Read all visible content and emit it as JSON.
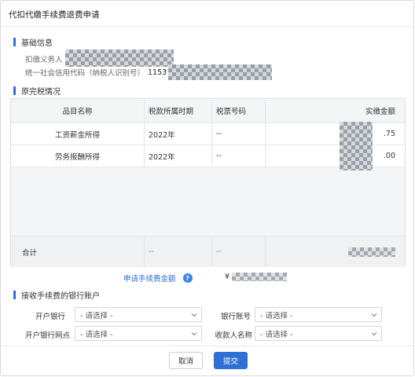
{
  "dialog": {
    "title": "代扣代缴手续费退费申请"
  },
  "basic_info": {
    "section_title": "基础信息",
    "withholder_label": "扣缴义务人",
    "credit_code_label": "统一社会信用代码（纳税人识别号）",
    "credit_code_value": "1153"
  },
  "tax_status": {
    "section_title": "原完税情况",
    "columns": [
      "品目名称",
      "税款所属时期",
      "税票号码",
      "实缴金额"
    ],
    "rows": [
      {
        "item": "工资薪金所得",
        "period": "2022年",
        "ticket": "--",
        "amount_suffix": ".75"
      },
      {
        "item": "劳务报酬所得",
        "period": "2022年",
        "ticket": "--",
        "amount_suffix": ".00"
      }
    ],
    "total": {
      "label": "合计",
      "period": "--",
      "ticket": "--"
    }
  },
  "fee": {
    "label": "申请手续费金额",
    "help_icon": "question-circle-icon",
    "currency": "¥"
  },
  "bank": {
    "section_title": "接收手续费的银行账户",
    "open_bank_label": "开户银行",
    "open_bank_value": "- 请选择 -",
    "account_label": "银行账号",
    "account_value": "- 请选择 -",
    "branch_label": "开户银行网点",
    "branch_value": "- 请选择 -",
    "payee_label": "收款人名称",
    "payee_value": "- 请选择 -"
  },
  "buttons": {
    "cancel": "取消",
    "submit": "提交"
  },
  "colors": {
    "accent": "#2f6fd6",
    "border": "#dcdfe4"
  }
}
